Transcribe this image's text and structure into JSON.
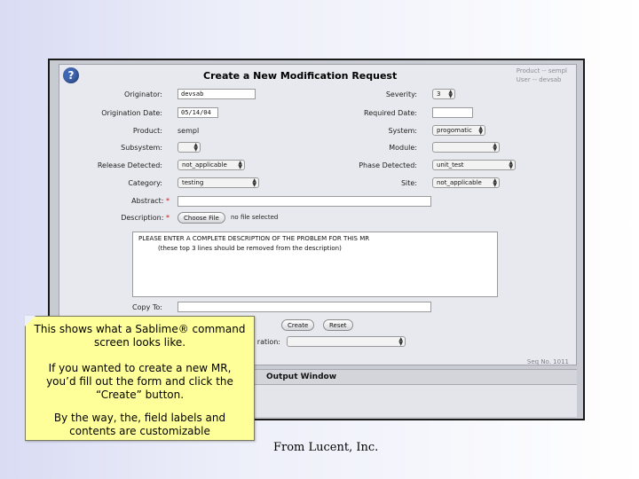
{
  "form": {
    "title": "Create a New Modification Request",
    "help_icon_glyph": "?",
    "corner_info": [
      "Product -- sempl",
      "User -- devsab"
    ],
    "sequence_no": "Seq No. 1011",
    "labels": {
      "originator": "Originator:",
      "origination_date": "Origination Date:",
      "product": "Product:",
      "subsystem": "Subsystem:",
      "release_detected": "Release Detected:",
      "category": "Category:",
      "abstract": "Abstract:",
      "description": "Description:",
      "severity": "Severity:",
      "required_date": "Required Date:",
      "system": "System:",
      "module": "Module:",
      "phase_detected": "Phase Detected:",
      "site": "Site:",
      "copy_to": "Copy To:",
      "required_marker": "*",
      "ration_fragment": "ration:"
    },
    "values": {
      "originator": "devsab",
      "origination_date": "05/14/04",
      "product": "sempl",
      "subsystem": "",
      "release_detected": "not_applicable",
      "category": "testing",
      "abstract": "",
      "severity": "3",
      "required_date": "",
      "system": "progomatic",
      "module": "",
      "phase_detected": "unit_test",
      "site": "not_applicable",
      "copy_to": "",
      "file_status": "no file selected"
    },
    "description_text": [
      "PLEASE ENTER A COMPLETE DESCRIPTION OF THE PROBLEM FOR THIS MR",
      "(these top 3 lines should be removed from the description)"
    ],
    "buttons": {
      "choose_file": "Choose File",
      "create": "Create",
      "reset": "Reset"
    }
  },
  "output_window": {
    "title": "Output Window"
  },
  "callout": {
    "line1": "This shows what a Sablime® command screen looks like.",
    "line2": "If you wanted to create a new MR, you’d fill out the form and click the “Create” button.",
    "line3": "By the way, the, field labels and contents are customizable"
  },
  "credit": "From Lucent, Inc.",
  "colors": {
    "callout_bg": "#ffff99",
    "required": "#d01010",
    "help_icon": "#3f66b3"
  }
}
